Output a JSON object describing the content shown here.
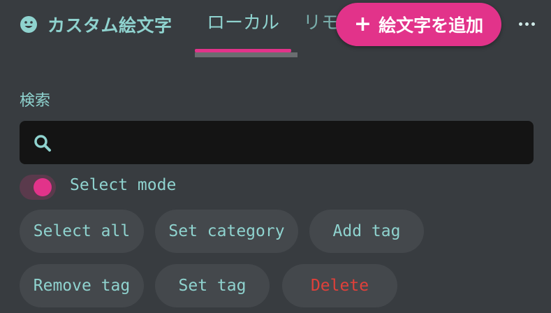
{
  "header": {
    "title": "カスタム絵文字",
    "tabs": [
      {
        "label": "ローカル"
      },
      {
        "label": "リモ"
      }
    ],
    "add_button_label": "絵文字を追加",
    "add_button_icon": "plus-icon",
    "more_icon": "more-horizontal-icon"
  },
  "search": {
    "label": "検索",
    "value": "",
    "icon": "search-icon"
  },
  "select_mode": {
    "label": "Select mode",
    "enabled": true
  },
  "actions": [
    {
      "label": "Select all"
    },
    {
      "label": "Set category"
    },
    {
      "label": "Add tag"
    },
    {
      "label": "Remove tag"
    },
    {
      "label": "Set tag"
    },
    {
      "label": "Delete"
    }
  ],
  "colors": {
    "background": "#383c40",
    "accent": "#e2338a",
    "text": "#8fd3cf",
    "danger": "#e0403a",
    "input_bg": "#141414",
    "chip_bg": "#44484c"
  }
}
